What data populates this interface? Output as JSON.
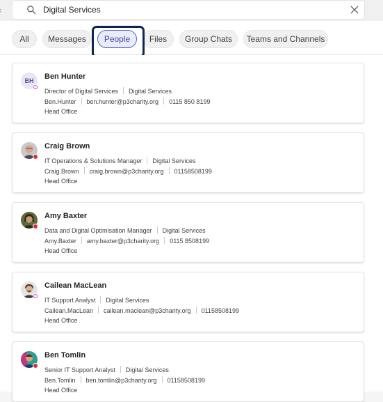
{
  "search": {
    "query": "Digital Services"
  },
  "filters": [
    "All",
    "Messages",
    "People",
    "Files",
    "Group Chats",
    "Teams and Channels"
  ],
  "active_filter": "People",
  "people": [
    {
      "name": "Ben Hunter",
      "initials": "BH",
      "title": "Director of Digital Services",
      "department": "Digital Services",
      "username": "Ben.Hunter",
      "email": "ben.hunter@p3charity.org",
      "phone": "0115 850 8199",
      "location": "Head Office",
      "presence": "offline"
    },
    {
      "name": "Craig Brown",
      "title": "IT Operations & Solutions Manager",
      "department": "Digital Services",
      "username": "Craig.Brown",
      "email": "craig.brown@p3charity.org",
      "phone": "01158508199",
      "location": "Head Office",
      "presence": "busy"
    },
    {
      "name": "Amy Baxter",
      "title": "Data and Digital Optimisation Manager",
      "department": "Digital Services",
      "username": "Amy.Baxter",
      "email": "amy.baxter@p3charity.org",
      "phone": "0115 8508199",
      "location": "Head Office",
      "presence": "busy"
    },
    {
      "name": "Cailean MacLean",
      "title": "IT Support Analyst",
      "department": "Digital Services",
      "username": "Cailean.MacLean",
      "email": "cailean.maclean@p3charity.org",
      "phone": "01158508199",
      "location": "Head Office",
      "presence": "offline"
    },
    {
      "name": "Ben Tomlin",
      "title": "Senior IT Support Analyst",
      "department": "Digital Services",
      "username": "Ben.Tomlin",
      "email": "ben.tomlin@p3charity.org",
      "phone": "01158508199",
      "location": "Head Office",
      "presence": "busy"
    }
  ],
  "colors": {
    "accent": "#5b5fc7",
    "focus_ring": "#0f2550",
    "busy": "#d13438",
    "offline_ring": "#c239b3"
  }
}
